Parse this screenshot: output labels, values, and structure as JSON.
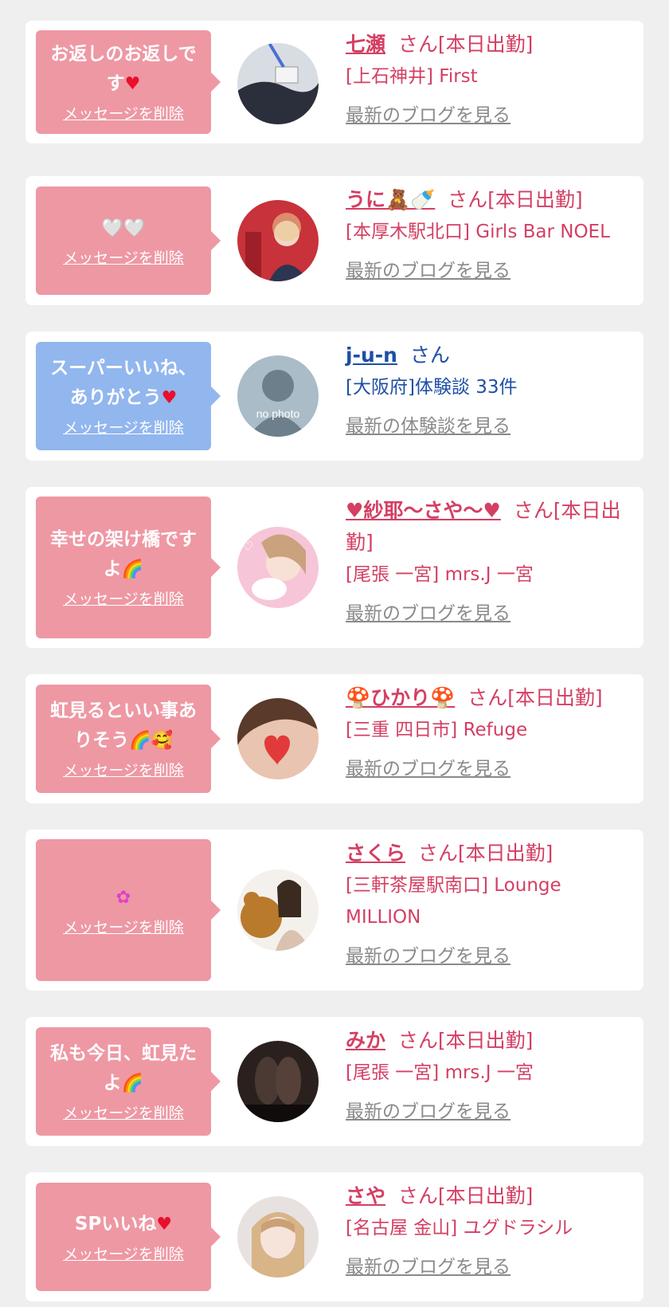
{
  "cards": [
    {
      "bubble_color": "pink",
      "message": "お返しのお返しです",
      "message_emoji": "♥",
      "delete_label": "メッセージを削除",
      "name": "七瀬",
      "suffix": "さん[本日出勤]",
      "shop": "[上石神井] First",
      "link": "最新のブログを見る",
      "avatar": "photo-lanyard"
    },
    {
      "bubble_color": "pink",
      "message": "",
      "message_emoji": "🤍🤍",
      "delete_label": "メッセージを削除",
      "name": "うに🧸🍼",
      "suffix": "さん[本日出勤]",
      "shop": "[本厚木駅北口] Girls Bar NOEL",
      "link": "最新のブログを見る",
      "avatar": "photo-red"
    },
    {
      "bubble_color": "blue",
      "message": "スーパーいいね、ありがとう",
      "message_emoji": "♥",
      "delete_label": "メッセージを削除",
      "name": "j-u-n",
      "suffix": "さん",
      "shop": "[大阪府]体験談 33件",
      "link": "最新の体験談を見る",
      "avatar": "no-photo",
      "avatar_text": "no photo"
    },
    {
      "bubble_color": "pink",
      "message": "幸せの架け橋ですよ",
      "message_emoji": "🌈",
      "delete_label": "メッセージを削除",
      "name": "♥紗耶〜さや〜♥",
      "suffix": "さん[本日出勤]",
      "shop": "[尾張 一宮] mrs.J 一宮",
      "link": "最新のブログを見る",
      "avatar": "photo-pink"
    },
    {
      "bubble_color": "pink",
      "message": "虹見るといい事ありそう",
      "message_emoji": "🌈🥰",
      "delete_label": "メッセージを削除",
      "name": "🍄ひかり🍄",
      "suffix": "さん[本日出勤]",
      "shop": "[三重 四日市] Refuge",
      "link": "最新のブログを見る",
      "avatar": "photo-heart"
    },
    {
      "bubble_color": "pink",
      "message": "",
      "message_emoji": "✿",
      "delete_label": "メッセージを削除",
      "name": "さくら",
      "suffix": "さん[本日出勤]",
      "shop": "[三軒茶屋駅南口] Lounge MILLION",
      "link": "最新のブログを見る",
      "avatar": "photo-bear"
    },
    {
      "bubble_color": "pink",
      "message": "私も今日、虹見たよ",
      "message_emoji": "🌈",
      "delete_label": "メッセージを削除",
      "name": "みか",
      "suffix": "さん[本日出勤]",
      "shop": "[尾張 一宮] mrs.J 一宮",
      "link": "最新のブログを見る",
      "avatar": "photo-dark"
    },
    {
      "bubble_color": "pink",
      "message": "SPいいね",
      "message_emoji": "♥",
      "delete_label": "メッセージを削除",
      "name": "さや",
      "suffix": "さん[本日出勤]",
      "shop": "[名古屋 金山] ユグドラシル",
      "link": "最新のブログを見る",
      "avatar": "photo-blonde"
    }
  ],
  "colors": {
    "pink_bubble": "#ee98a4",
    "blue_bubble": "#92b6ee",
    "pink_text": "#d43f63",
    "blue_text": "#1f4fa6",
    "link_gray": "#8a8a8a"
  }
}
